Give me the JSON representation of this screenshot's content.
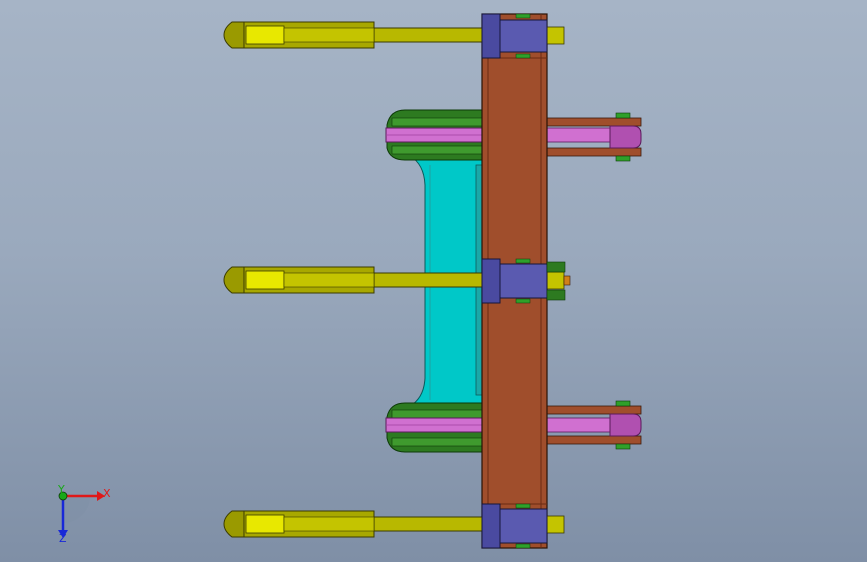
{
  "viewport": {
    "background_top": "#a6b4c6",
    "background_bottom": "#7f8fa6"
  },
  "triad": {
    "x_label": "X",
    "y_label": "Y",
    "z_label": "Z",
    "x_color": "#e01818",
    "y_color": "#18a818",
    "z_color": "#1828d8"
  },
  "colors": {
    "frame_plate": "#a04e2c",
    "rod": "#b8b800",
    "rod_tip": "#e8e800",
    "clamp_block": "#5a5ab0",
    "cyan_part": "#00c8c8",
    "pink_arm": "#d070d0",
    "green_part": "#2d7a20"
  },
  "icons": [
    "coordinate-triad-icon"
  ]
}
